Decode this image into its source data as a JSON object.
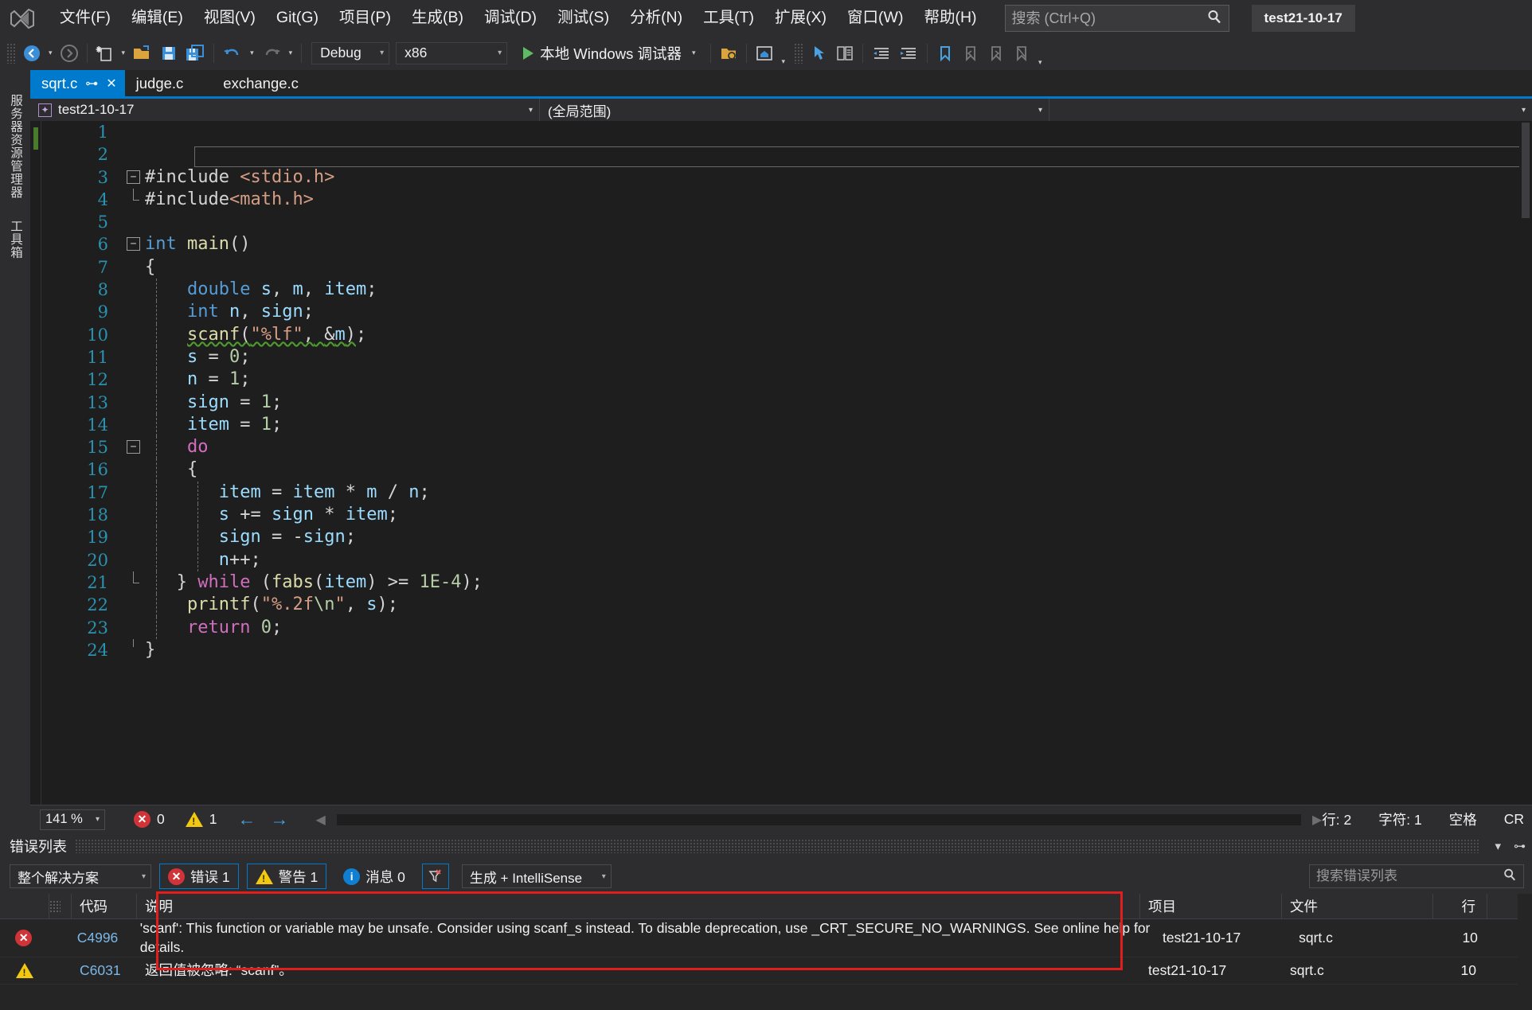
{
  "menu": {
    "logo_icon": "visual-studio-logo",
    "items": [
      {
        "label": "文件(F)"
      },
      {
        "label": "编辑(E)"
      },
      {
        "label": "视图(V)"
      },
      {
        "label": "Git(G)"
      },
      {
        "label": "项目(P)"
      },
      {
        "label": "生成(B)"
      },
      {
        "label": "调试(D)"
      },
      {
        "label": "测试(S)"
      },
      {
        "label": "分析(N)"
      },
      {
        "label": "工具(T)"
      },
      {
        "label": "扩展(X)"
      },
      {
        "label": "窗口(W)"
      },
      {
        "label": "帮助(H)"
      }
    ],
    "search_placeholder": "搜索 (Ctrl+Q)",
    "search_value": "",
    "search_icon": "search-icon",
    "project_badge": "test21-10-17"
  },
  "toolbar": {
    "back_icon": "arrow-back-icon",
    "forward_icon": "arrow-forward-icon",
    "new_item_icon": "new-item-icon",
    "open_icon": "open-folder-icon",
    "save_icon": "save-icon",
    "save_all_icon": "save-all-icon",
    "undo_icon": "undo-icon",
    "redo_icon": "redo-icon",
    "configuration": "Debug",
    "platform": "x86",
    "run_label": "本地 Windows 调试器",
    "run_icon": "play-icon",
    "attach_icon": "attach-process-icon",
    "home_icon": "home-window-icon",
    "select_icon": "pointer-select-icon",
    "compare_icon": "compare-icon",
    "indent_icon": "indent-icon",
    "outdent_icon": "outdent-icon",
    "bookmark_icon": "bookmark-icon",
    "bm_prev_icon": "bookmark-prev-icon",
    "bm_next_icon": "bookmark-next-icon",
    "bm_clear_icon": "bookmark-clear-icon"
  },
  "rail": {
    "items": [
      {
        "label": "服务器资源管理器",
        "icon": "server-explorer-icon"
      },
      {
        "label": "工具箱",
        "icon": "toolbox-icon"
      }
    ]
  },
  "tabs": [
    {
      "label": "sqrt.c",
      "active": true,
      "pin_icon": "pin-icon",
      "close_icon": "close-icon"
    },
    {
      "label": "judge.c",
      "active": false
    },
    {
      "label": "exchange.c",
      "active": false
    }
  ],
  "navbar": {
    "project_icon": "project-scope-icon",
    "project": "test21-10-17",
    "scope": "(全局范围)",
    "member": ""
  },
  "editor": {
    "lines": [
      {
        "no": "1",
        "text": ""
      },
      {
        "no": "2",
        "text": ""
      },
      {
        "no": "3",
        "text": "#include <stdio.h>"
      },
      {
        "no": "4",
        "text": " #include<math.h>"
      },
      {
        "no": "5",
        "text": ""
      },
      {
        "no": "6",
        "text": "int main()"
      },
      {
        "no": "7",
        "text": " {"
      },
      {
        "no": "8",
        "text": "     double s, m, item;"
      },
      {
        "no": "9",
        "text": "     int n, sign;"
      },
      {
        "no": "10",
        "text": "     scanf(\"%lf\", &m);"
      },
      {
        "no": "11",
        "text": "     s = 0;"
      },
      {
        "no": "12",
        "text": "     n = 1;"
      },
      {
        "no": "13",
        "text": "     sign = 1;"
      },
      {
        "no": "14",
        "text": "     item = 1;"
      },
      {
        "no": "15",
        "text": "     do"
      },
      {
        "no": "16",
        "text": "     {"
      },
      {
        "no": "17",
        "text": "        item = item * m / n;"
      },
      {
        "no": "18",
        "text": "        s += sign * item;"
      },
      {
        "no": "19",
        "text": "        sign = -sign;"
      },
      {
        "no": "20",
        "text": "        n++;"
      },
      {
        "no": "21",
        "text": "     } while (fabs(item) >= 1E-4);"
      },
      {
        "no": "22",
        "text": "     printf(\"%.2f\\n\", s);"
      },
      {
        "no": "23",
        "text": "     return 0;"
      },
      {
        "no": "24",
        "text": " }"
      }
    ]
  },
  "editor_status": {
    "zoom": "141 %",
    "error_count": "0",
    "warning_count": "1",
    "prev_icon": "arrow-left-icon",
    "next_icon": "arrow-right-icon",
    "line_label": "行: 2",
    "col_label": "字符: 1",
    "insert_mode": "空格",
    "eol": "CR"
  },
  "error_list": {
    "title": "错误列表",
    "dropdown_icon": "chevron-down-icon",
    "pin_icon": "pin-icon",
    "close_icon": "close-icon",
    "scope": "整个解决方案",
    "errors_label": "错误 1",
    "warnings_label": "警告 1",
    "messages_label": "消息 0",
    "filter_icon": "clear-filter-icon",
    "source": "生成 + IntelliSense",
    "search_placeholder": "搜索错误列表",
    "search_value": "",
    "search_icon": "search-icon",
    "columns": [
      "",
      "",
      "代码",
      "说明",
      "项目",
      "文件",
      "行"
    ],
    "rows": [
      {
        "severity": "error",
        "severity_icon": "error-icon",
        "code": "C4996",
        "description": "'scanf': This function or variable may be unsafe. Consider using scanf_s instead. To disable deprecation, use _CRT_SECURE_NO_WARNINGS. See online help for details.",
        "project": "test21-10-17",
        "file": "sqrt.c",
        "line": "10"
      },
      {
        "severity": "warning",
        "severity_icon": "warning-icon",
        "code": "C6031",
        "description": "返回值被忽略: “scanf”。",
        "project": "test21-10-17",
        "file": "sqrt.c",
        "line": "10"
      }
    ],
    "annotation_box_color": "#e01e1e"
  },
  "colors": {
    "accent": "#007acc",
    "chrome": "#2d2d30",
    "editor_bg": "#1e1e1e",
    "error_red": "#d13438",
    "warning_yellow": "#f2c811"
  }
}
